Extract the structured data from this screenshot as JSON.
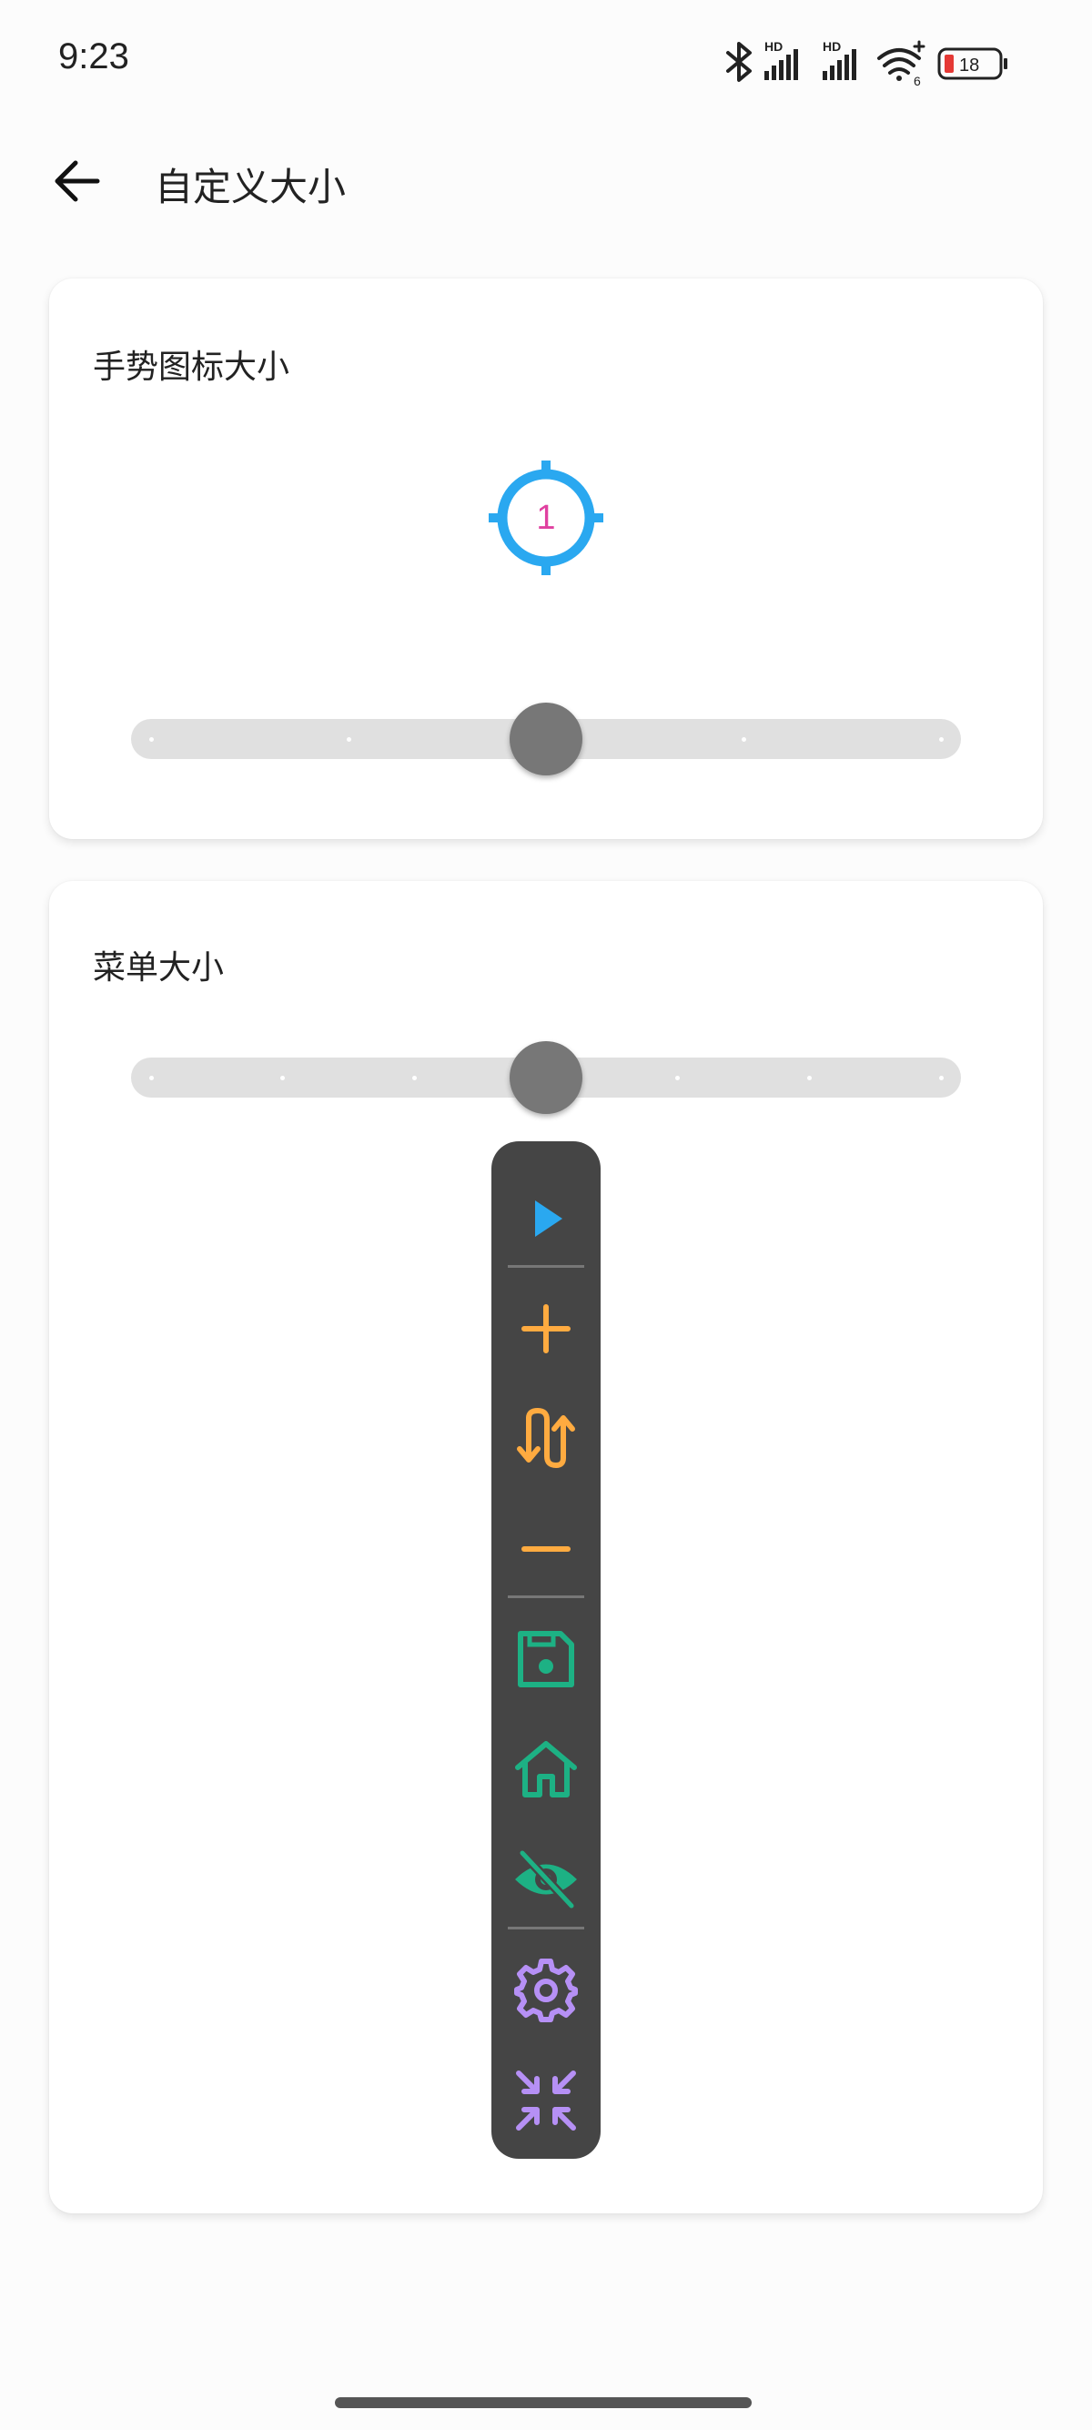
{
  "status_bar": {
    "time": "9:23",
    "battery_level": "18",
    "wifi_badge": "6",
    "signal_badge": "HD"
  },
  "header": {
    "title": "自定义大小",
    "back_icon": "arrow-left-icon"
  },
  "gesture_card": {
    "title": "手势图标大小",
    "preview_number": "1",
    "preview_icon": "crosshair-icon",
    "preview_color": "#2aa8f0",
    "slider": {
      "position_fraction": 0.5,
      "tick_count": 5
    }
  },
  "menu_card": {
    "title": "菜单大小",
    "slider": {
      "position_fraction": 0.5,
      "tick_count": 7
    },
    "menu_items": [
      {
        "icon": "play-icon",
        "color": "#2aa8f0"
      },
      {
        "icon": "plus-icon",
        "color": "#ffab40"
      },
      {
        "icon": "swap-vertical-arrows-icon",
        "color": "#ffab40"
      },
      {
        "icon": "minus-icon",
        "color": "#ffab40"
      },
      {
        "icon": "save-floppy-icon",
        "color": "#1db184"
      },
      {
        "icon": "home-icon",
        "color": "#1db184"
      },
      {
        "icon": "eye-off-icon",
        "color": "#1db184"
      },
      {
        "icon": "gear-icon",
        "color": "#b690f5"
      },
      {
        "icon": "collapse-icon",
        "color": "#b690f5"
      }
    ]
  }
}
